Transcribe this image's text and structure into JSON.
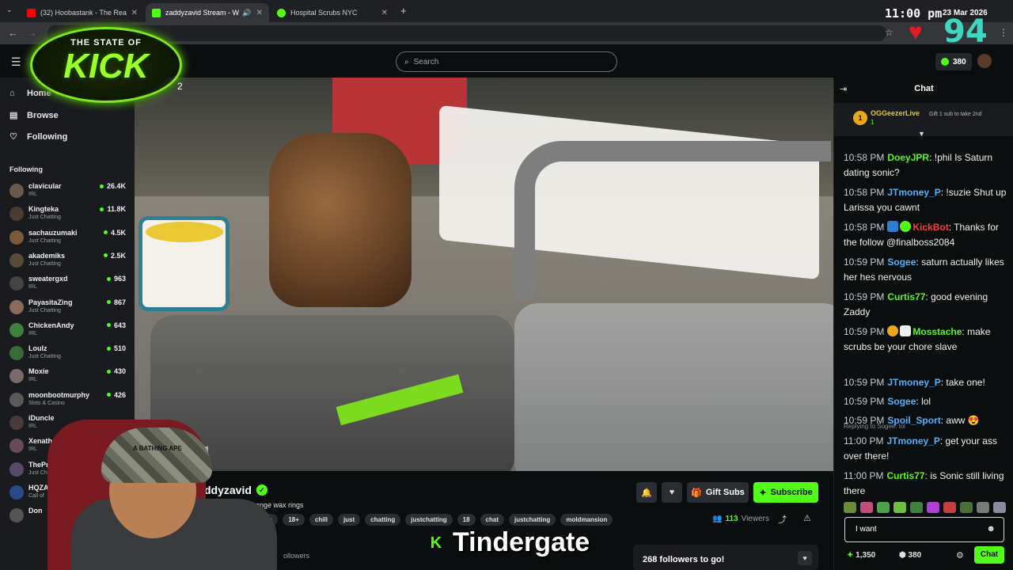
{
  "browser": {
    "tabs": [
      {
        "title": "(32) Hoobastank - The Reason (",
        "favicon_color": "#ff0000"
      },
      {
        "title": "zaddyzavid Stream - Watch",
        "favicon_color": "#53fc18"
      },
      {
        "title": "Hospital Scrubs NYC",
        "favicon_color": "#53fc18"
      }
    ],
    "new_tab": "+"
  },
  "overlay": {
    "clock": "11:00 pm",
    "date": "23 Mar 2026",
    "counter": "94",
    "logo_line1": "THE STATE OF",
    "logo_line2": "KICK",
    "page_badge": "2",
    "caption": "Tindergate"
  },
  "header": {
    "search_placeholder": "Search",
    "points": "380"
  },
  "sidebar": {
    "nav": [
      {
        "label": "Home",
        "icon": "home-icon"
      },
      {
        "label": "Browse",
        "icon": "browse-icon"
      },
      {
        "label": "Following",
        "icon": "heart-icon"
      }
    ],
    "following_header": "Following",
    "following": [
      {
        "name": "clavicular",
        "category": "IRL",
        "viewers": "26.4K"
      },
      {
        "name": "Kingteka",
        "category": "Just Chatting",
        "viewers": "11.8K"
      },
      {
        "name": "sachauzumaki",
        "category": "Just Chatting",
        "viewers": "4.5K"
      },
      {
        "name": "akademiks",
        "category": "Just Chatting",
        "viewers": "2.5K"
      },
      {
        "name": "sweatergxd",
        "category": "IRL",
        "viewers": "963"
      },
      {
        "name": "PayasitaZing",
        "category": "Just Chatting",
        "viewers": "867"
      },
      {
        "name": "ChickenAndy",
        "category": "IRL",
        "viewers": "643"
      },
      {
        "name": "Loulz",
        "category": "Just Chatting",
        "viewers": "510"
      },
      {
        "name": "Moxie",
        "category": "IRL",
        "viewers": "430"
      },
      {
        "name": "moonbootmurphy",
        "category": "Slots & Casino",
        "viewers": "426"
      },
      {
        "name": "iDuncle",
        "category": "IRL",
        "viewers": ""
      },
      {
        "name": "Xenathewitch",
        "category": "IRL",
        "viewers": ""
      },
      {
        "name": "ThePrawnce",
        "category": "Just Chatting",
        "viewers": ""
      },
      {
        "name": "HQZAOP",
        "category": "Call of",
        "viewers": ""
      },
      {
        "name": "Don",
        "category": "",
        "viewers": ""
      }
    ]
  },
  "video": {
    "cam_label": "ddyzavid"
  },
  "stream": {
    "streamer": "ddyzavid",
    "title": "i will change wax rings",
    "tags": [
      "sh",
      "18+",
      "chill",
      "just",
      "chatting",
      "justchatting",
      "18",
      "chat",
      "justchatting",
      "moldmansion"
    ],
    "followers_label": "ollowers",
    "gift_subs": "Gift Subs",
    "subscribe": "Subscribe",
    "viewers": "113",
    "viewers_label": "Viewers",
    "goal": "268 followers to go!"
  },
  "chat": {
    "title": "Chat",
    "pinned": {
      "rank": "1",
      "user": "OGGeezerLive",
      "sub": "1",
      "gift_text": "Gift 1 sub to take 2nd"
    },
    "messages": [
      {
        "time": "10:58 PM",
        "user": "DoeyJPR",
        "color": "#53fc18",
        "text": "!phil Is Saturn dating sonic?"
      },
      {
        "time": "10:58 PM",
        "user": "JTmoney_P",
        "color": "#4fb3ff",
        "text": "!suzie Shut up Larissa you cawnt"
      },
      {
        "time": "10:58 PM",
        "user": "KickBot",
        "color": "#ff3b3b",
        "text": "Thanks for the follow @finalboss2084"
      },
      {
        "time": "10:59 PM",
        "user": "Sogee",
        "color": "#4fb3ff",
        "text": "saturn actually likes her hes nervous"
      },
      {
        "time": "10:59 PM",
        "user": "Curtis77",
        "color": "#53fc18",
        "text": "good evening Zaddy"
      },
      {
        "time": "10:59 PM",
        "user": "Mosstache",
        "color": "#53fc18",
        "text": "make scrubs be your chore slave"
      },
      {
        "time": "10:59 PM",
        "user": "JTmoney_P",
        "color": "#4fb3ff",
        "text": "take one!"
      },
      {
        "time": "10:59 PM",
        "user": "Sogee",
        "color": "#4fb3ff",
        "text": "lol"
      },
      {
        "time": "10:59 PM",
        "user": "Spoil_Sport",
        "color": "#4fb3ff",
        "text": "aww"
      },
      {
        "time": "11:00 PM",
        "user": "JTmoney_P",
        "color": "#4fb3ff",
        "text": "get your ass over there!"
      },
      {
        "time": "11:00 PM",
        "user": "Curtis77",
        "color": "#53fc18",
        "text": "is Sonic still living there"
      }
    ],
    "reply_note": "Replying to Sogee: lol",
    "input_value": "I want",
    "footer_points": "1,350",
    "footer_count": "380",
    "send": "Chat"
  }
}
